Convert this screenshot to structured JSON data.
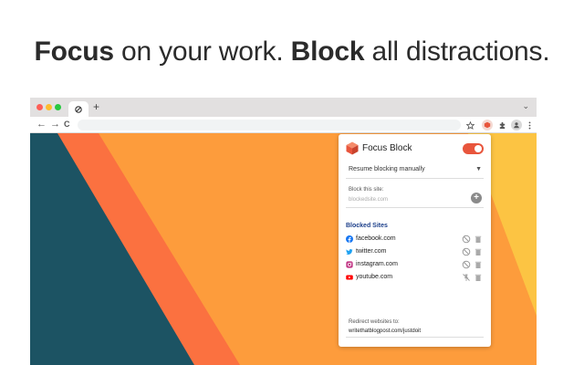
{
  "headline": {
    "focus": "Focus",
    "mid": " on your work. ",
    "block": "Block",
    "end": " all distractions."
  },
  "browser": {
    "new_tab_symbol": "+",
    "tab_menu_symbol": "⌄",
    "back_symbol": "←",
    "forward_symbol": "→",
    "reload_symbol": "C"
  },
  "popup": {
    "title": "Focus Block",
    "toggle_on": true,
    "resume_option": "Resume blocking manually",
    "block_site_label": "Block this site:",
    "block_site_placeholder": "blockedsite.com",
    "blocked_sites_title": "Blocked Sites",
    "blocked_sites": [
      {
        "name": "facebook.com",
        "icon": "facebook-icon",
        "color": "#1877f2"
      },
      {
        "name": "twitter.com",
        "icon": "twitter-icon",
        "color": "#1da1f2"
      },
      {
        "name": "instagram.com",
        "icon": "instagram-icon",
        "color": "#c13584"
      },
      {
        "name": "youtube.com",
        "icon": "youtube-icon",
        "color": "#ff0000"
      }
    ],
    "redirect_label": "Redirect websites to:",
    "redirect_value": "writethatblogpost.com/justdoit"
  },
  "colors": {
    "accent": "#e8553c",
    "teal": "#1c5363",
    "orange_light": "#fd9c3c",
    "orange_dark": "#fb7140",
    "yellow": "#fcc443"
  }
}
